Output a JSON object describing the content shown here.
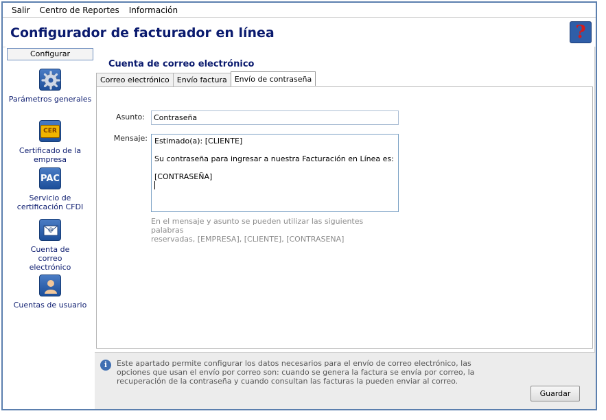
{
  "menu": {
    "items": [
      "Salir",
      "Centro de Reportes",
      "Información"
    ]
  },
  "header": {
    "title": "Configurador de facturador en línea",
    "help_icon": "question-mark-icon"
  },
  "sidebar": {
    "header": "Configurar",
    "items": [
      {
        "label": "Parámetros generales",
        "icon": "gear-icon"
      },
      {
        "label": "Certificado de la empresa",
        "icon": "certificate-icon",
        "icon_text": "CER"
      },
      {
        "label": "Servicio de certificación CFDI",
        "icon": "pac-icon",
        "icon_text": "PAC"
      },
      {
        "label": "Cuenta de correo electrónico",
        "icon": "email-icon"
      },
      {
        "label": "Cuentas de usuario",
        "icon": "user-icon"
      }
    ]
  },
  "main": {
    "section_title": "Cuenta de correo electrónico",
    "tabs": [
      {
        "label": "Correo electrónico",
        "active": false
      },
      {
        "label": "Envío factura",
        "active": false
      },
      {
        "label": "Envío de contraseña",
        "active": true
      }
    ],
    "form": {
      "subject_label": "Asunto:",
      "subject_value": "Contraseña",
      "message_label": "Mensaje:",
      "message_lines": [
        "Estimado(a): [CLIENTE]",
        "",
        "Su contraseña para ingresar a nuestra Facturación en Línea es:",
        "",
        "[CONTRASEÑA]"
      ],
      "hint_line1": "En el mensaje y asunto se pueden utilizar las siguientes palabras",
      "hint_line2": "reservadas, [EMPRESA], [CLIENTE], [CONTRASENA]"
    },
    "info": {
      "line1": "Este apartado permite configurar los datos necesarios para el envío de correo electrónico, las",
      "line2": "opciones que usan el envío por correo son: cuando se genera la factura se envía por correo, la",
      "line3": "recuperación de la contraseña y cuando consultan las facturas la pueden enviar al correo."
    },
    "save_label": "Guardar"
  },
  "colors": {
    "accent": "#0a1a6e",
    "window_border": "#5b7fae",
    "icon_blue": "#2f5ea8",
    "help_red": "#d41c1c"
  }
}
